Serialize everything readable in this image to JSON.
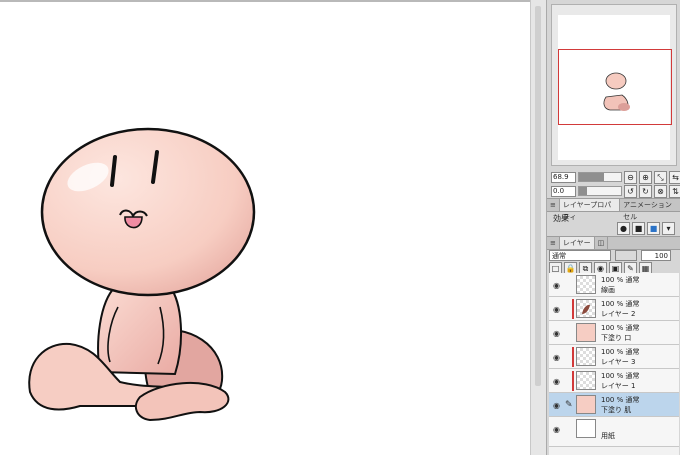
{
  "navigator": {
    "zoom_value": "68.9",
    "rotate_value": "0.0"
  },
  "panel_tabs": [
    {
      "label": "レイヤープロパティ"
    },
    {
      "label": "アニメーションセル"
    }
  ],
  "effect": {
    "label": "効果"
  },
  "layer_tabs": [
    {
      "label": "レイヤー"
    }
  ],
  "blend": {
    "mode": "通常",
    "opacity": "100"
  },
  "layers": [
    {
      "mode": "100 % 通常",
      "name": "線画",
      "selected": false
    },
    {
      "mode": "100 % 通常",
      "name": "レイヤー 2",
      "selected": false
    },
    {
      "mode": "100 % 通常",
      "name": "下塗り 口",
      "selected": false
    },
    {
      "mode": "100 % 通常",
      "name": "レイヤー 3",
      "selected": false
    },
    {
      "mode": "100 % 通常",
      "name": "レイヤー 1",
      "selected": false
    },
    {
      "mode": "100 % 通常",
      "name": "下塗り 肌",
      "selected": true
    },
    {
      "mode": "",
      "name": "用紙",
      "selected": false
    }
  ],
  "colors": {
    "skin": "#f7cfc4",
    "skin_shade": "#d99a94",
    "line": "#1a1a1a",
    "selected_layer": "#bcd5ec",
    "nav_frame": "#d23a3a"
  }
}
